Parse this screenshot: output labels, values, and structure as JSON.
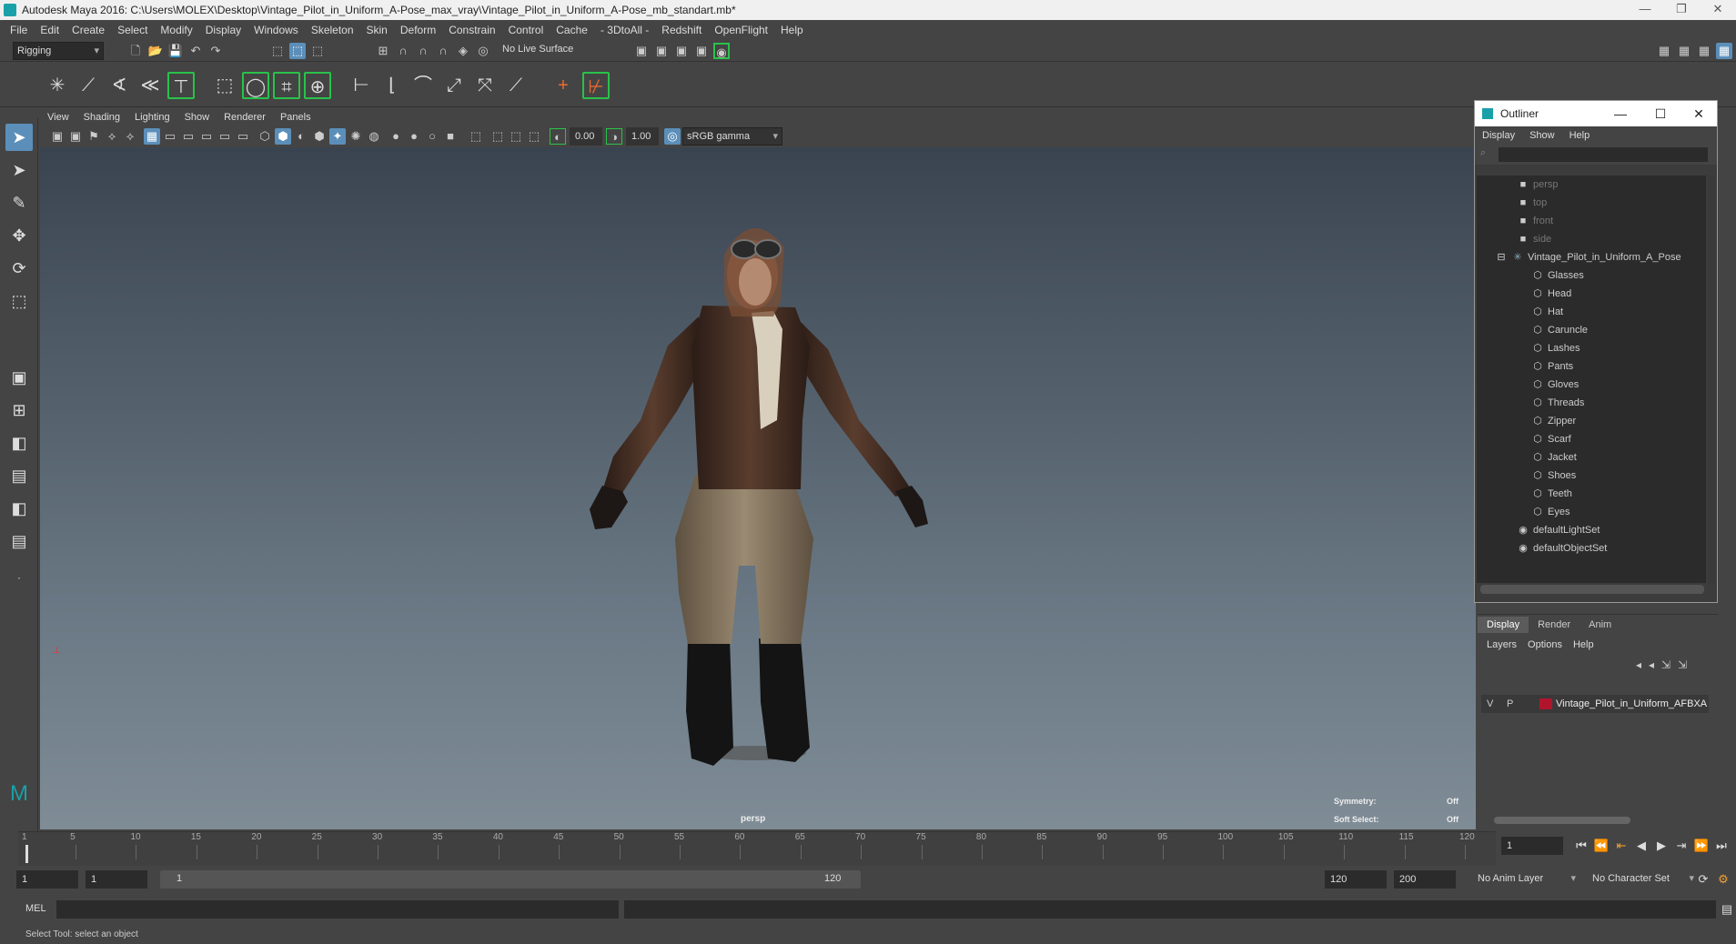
{
  "window": {
    "title": "Autodesk Maya 2016: C:\\Users\\MOLEX\\Desktop\\Vintage_Pilot_in_Uniform_A-Pose_max_vray\\Vintage_Pilot_in_Uniform_A-Pose_mb_standart.mb*",
    "minimize": "—",
    "restore": "❐",
    "close": "✕"
  },
  "menubar": [
    "File",
    "Edit",
    "Create",
    "Select",
    "Modify",
    "Display",
    "Windows",
    "Skeleton",
    "Skin",
    "Deform",
    "Constrain",
    "Control",
    "Cache",
    "- 3DtoAll -",
    "Redshift",
    "OpenFlight",
    "Help"
  ],
  "status_line": {
    "menuset": "Rigging",
    "live_surface": "No Live Surface"
  },
  "panel": {
    "menus": [
      "View",
      "Shading",
      "Lighting",
      "Show",
      "Renderer",
      "Panels"
    ],
    "exposure": "0.00",
    "gamma": "1.00",
    "color_space": "sRGB gamma"
  },
  "viewport": {
    "camera_label": "persp",
    "symmetry_label": "Symmetry:",
    "symmetry_value": "Off",
    "soft_select_label": "Soft Select:",
    "soft_select_value": "Off"
  },
  "outliner": {
    "title": "Outliner",
    "menus": [
      "Display",
      "Show",
      "Help"
    ],
    "cameras": [
      "persp",
      "top",
      "front",
      "side"
    ],
    "group": "Vintage_Pilot_in_Uniform_A_Pose",
    "children": [
      "Glasses",
      "Head",
      "Hat",
      "Caruncle",
      "Lashes",
      "Pants",
      "Gloves",
      "Threads",
      "Zipper",
      "Scarf",
      "Jacket",
      "Shoes",
      "Teeth",
      "Eyes"
    ],
    "sets": [
      "defaultLightSet",
      "defaultObjectSet"
    ]
  },
  "layer_editor": {
    "tabs": [
      "Display",
      "Render",
      "Anim"
    ],
    "menus": [
      "Layers",
      "Options",
      "Help"
    ],
    "layer": {
      "v": "V",
      "p": "P",
      "name": "Vintage_Pilot_in_Uniform_AFBXA",
      "color": "#b0152c"
    }
  },
  "timeline": {
    "ticks": [
      "1",
      "5",
      "10",
      "15",
      "20",
      "25",
      "30",
      "35",
      "40",
      "45",
      "50",
      "55",
      "60",
      "65",
      "70",
      "75",
      "80",
      "85",
      "90",
      "95",
      "100",
      "105",
      "110",
      "115",
      "120"
    ],
    "current_frame": "1"
  },
  "range": {
    "start": "1",
    "playback_start": "1",
    "slider_start": "1",
    "slider_end": "120",
    "playback_end": "120",
    "end": "200",
    "anim_layer": "No Anim Layer",
    "character_set": "No Character Set"
  },
  "command": {
    "language": "MEL"
  },
  "help_line": "Select Tool: select an object",
  "colors": {
    "accent": "#5b8fb9",
    "shelf_highlight": "#29c24a",
    "maya_teal": "#1aa0a8"
  }
}
